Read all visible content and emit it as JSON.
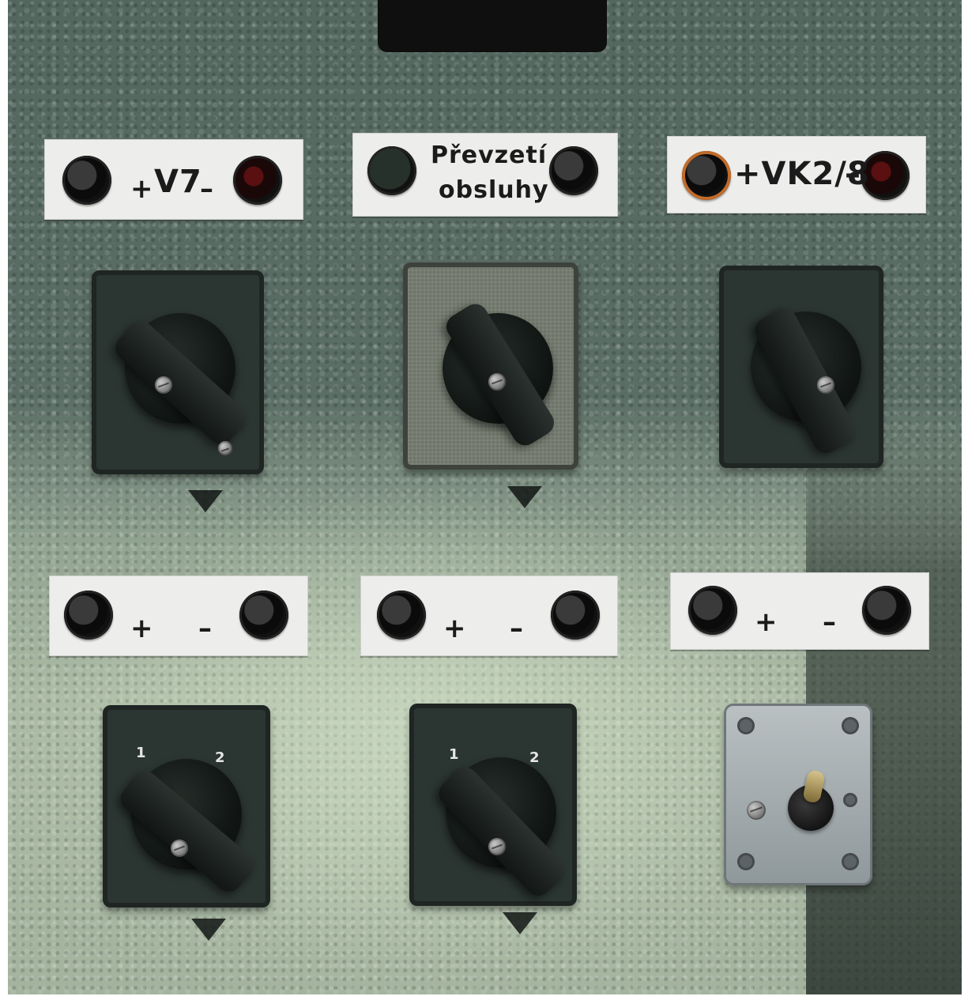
{
  "top_labels": [
    {
      "part1": "+",
      "part2": "V7",
      "part3": "–"
    },
    {
      "line1": "Převzetí",
      "line2": "obsluhy"
    },
    {
      "part1": "+VK2/8",
      "part2": "–"
    }
  ],
  "polarity_labels": [
    {
      "plus": "+",
      "minus": "–"
    },
    {
      "plus": "+",
      "minus": "–"
    },
    {
      "plus": "+",
      "minus": "–"
    }
  ],
  "rotary_positions": {
    "left": {
      "pos1": "1",
      "pos2": "2"
    },
    "middle": {
      "pos1": "1",
      "pos2": "2"
    }
  }
}
